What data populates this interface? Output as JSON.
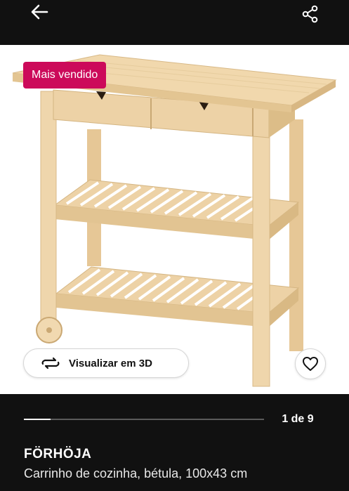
{
  "header": {
    "back_icon": "arrow-left-icon",
    "share_icon": "share-icon"
  },
  "product_image": {
    "badge": "Mais vendido",
    "view_3d_label": "Visualizar em 3D",
    "view_3d_icon": "rotate-3d-icon",
    "favorite_icon": "heart-icon"
  },
  "gallery": {
    "counter": "1 de 9",
    "progress": 0.11
  },
  "product": {
    "name": "FÖRHÖJA",
    "description": "Carrinho de cozinha, bétula, 100x43 cm"
  },
  "colors": {
    "background": "#111111",
    "badge": "#cc0a5a",
    "wood": "#ebcf9f"
  }
}
